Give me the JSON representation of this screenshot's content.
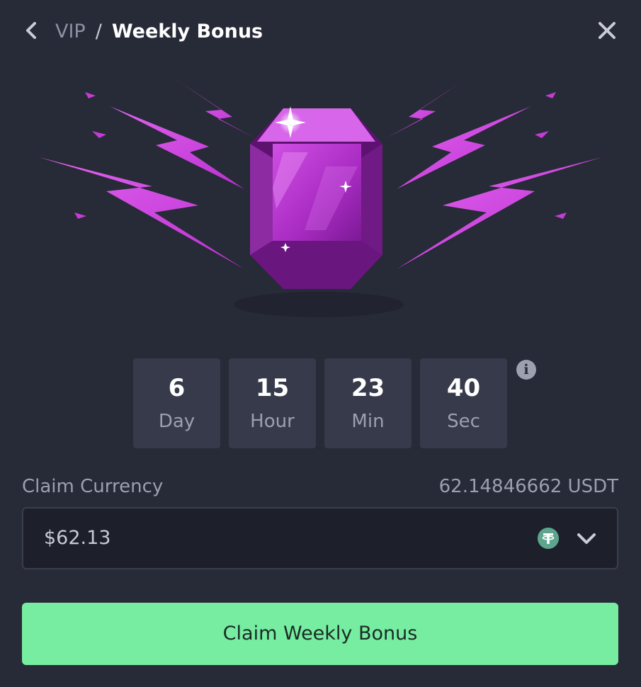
{
  "header": {
    "back_icon": "chevron-left-icon",
    "breadcrumb": {
      "parent": "VIP",
      "separator": "/",
      "current": "Weekly Bonus"
    },
    "close_icon": "close-icon"
  },
  "hero": {
    "icon": "gem-with-lightning-icon",
    "accent_color": "#c43cd6"
  },
  "countdown": {
    "items": [
      {
        "value": "6",
        "unit": "Day"
      },
      {
        "value": "15",
        "unit": "Hour"
      },
      {
        "value": "23",
        "unit": "Min"
      },
      {
        "value": "40",
        "unit": "Sec"
      }
    ],
    "info_icon": "info-icon",
    "info_glyph": "i"
  },
  "claim": {
    "label": "Claim Currency",
    "balance": "62.14846662 USDT",
    "selected_amount": "$62.13",
    "currency_icon": "tether-icon",
    "dropdown_icon": "chevron-down-icon"
  },
  "actions": {
    "claim_button_label": "Claim Weekly Bonus",
    "claim_button_color": "#76eda0"
  },
  "colors": {
    "background": "#272a37",
    "panel": "#363a4a",
    "input_background": "#1d1f2a",
    "muted_text": "#9ba0b1"
  }
}
